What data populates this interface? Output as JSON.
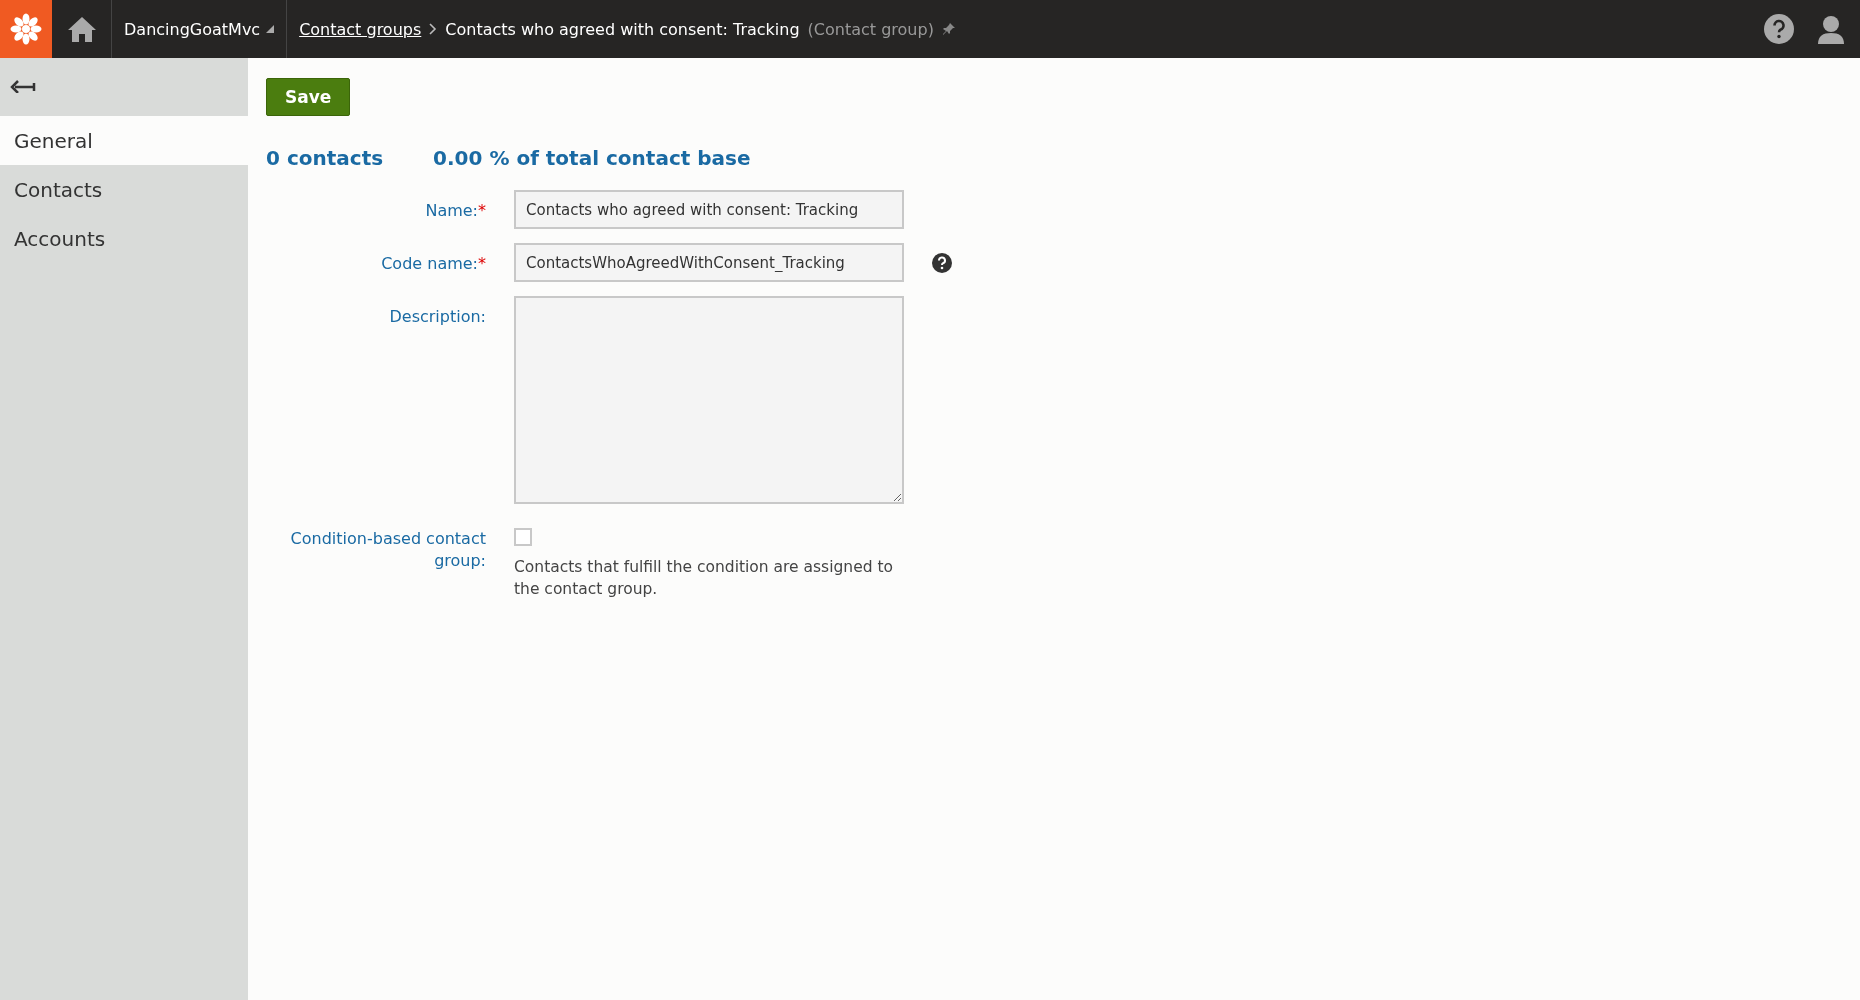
{
  "header": {
    "site": "DancingGoatMvc",
    "breadcrumbs": [
      {
        "label": "Contact groups",
        "kind": "link"
      },
      {
        "label": "Contacts who agreed with consent: Tracking",
        "kind": "current"
      }
    ],
    "object_type": "(Contact group)"
  },
  "sidebar": {
    "items": [
      {
        "label": "General",
        "selected": true
      },
      {
        "label": "Contacts",
        "selected": false
      },
      {
        "label": "Accounts",
        "selected": false
      }
    ]
  },
  "toolbar": {
    "save": "Save"
  },
  "stats": {
    "contacts": "0 contacts",
    "share": "0.00 % of total contact base"
  },
  "fields": [
    {
      "kind": "text",
      "label": "Name:",
      "required_mark": "*",
      "value": "Contacts who agreed with consent: Tracking",
      "help": false
    },
    {
      "kind": "text",
      "label": "Code name:",
      "required_mark": "*",
      "value": "ContactsWhoAgreedWithConsent_Tracking",
      "help": true
    },
    {
      "kind": "textarea",
      "label": "Description:"
    },
    {
      "kind": "checkbox",
      "label": "Condition-based contact group:",
      "checked": false,
      "hint": "Contacts that fulfill the condition are assigned to the contact group."
    }
  ]
}
